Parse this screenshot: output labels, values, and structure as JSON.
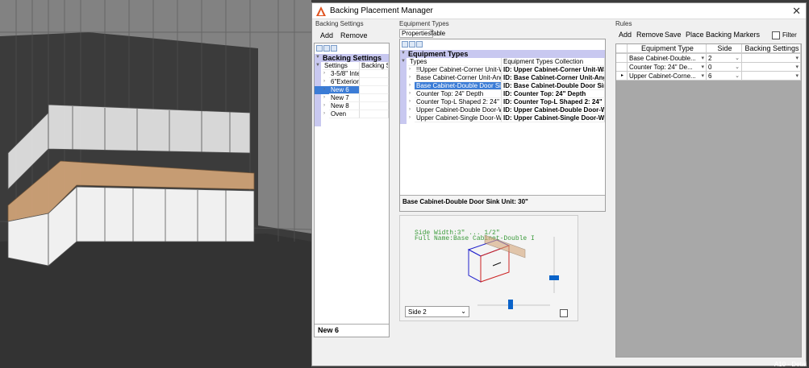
{
  "window": {
    "title": "Backing Placement Manager",
    "close": "✕"
  },
  "backing_settings": {
    "group_label": "Backing Settings",
    "add_label": "Add",
    "remove_label": "Remove",
    "header": "Backing Settings",
    "col_settings": "Settings",
    "col_backing": "Backing Se",
    "items": [
      "3-5/8\" Interi",
      "6\"ExteriorW",
      "New 6",
      "New 7",
      "New 8",
      "Oven"
    ],
    "selected_index": 2,
    "footer": "New 6"
  },
  "equipment_types": {
    "group_label": "Equipment Types",
    "tabs": [
      "Properties",
      "Table"
    ],
    "header": "Equipment Types",
    "col_types": "Types",
    "col_collection": "Equipment Types Collection",
    "rows": [
      {
        "type": "!!Upper Cabinet-Corner Unit-Wa",
        "id": "ID: Upper Cabinet-Corner Unit-Wall"
      },
      {
        "type": "Base Cabinet-Corner Unit-Angle",
        "id": "ID: Base Cabinet-Corner Unit-Angle"
      },
      {
        "type": "Base Cabinet-Double Door Sink",
        "id": "ID: Base Cabinet-Double Door Sink"
      },
      {
        "type": "Counter Top: 24\" Depth",
        "id": "ID: Counter Top: 24\" Depth"
      },
      {
        "type": "Counter Top-L Shaped 2: 24\" De",
        "id": "ID: Counter Top-L Shaped 2: 24\" De"
      },
      {
        "type": "Upper Cabinet-Double Door-Wal",
        "id": "ID: Upper Cabinet-Double Door-Wa"
      },
      {
        "type": "Upper Cabinet-Single Door-Wall",
        "id": "ID: Upper Cabinet-Single Door-Wall"
      }
    ],
    "selected_index": 2,
    "description": "Base Cabinet-Double Door Sink Unit: 30\""
  },
  "preview": {
    "text_line1": "Side Width:3\"  ... 1/2\"",
    "text_line2": "Full Name:Base Cabinet-Double I",
    "side_select": "Side 2"
  },
  "rules": {
    "group_label": "Rules",
    "add_label": "Add",
    "remove_label": "Remove",
    "save_label": "Save",
    "place_label": "Place Backing Markers",
    "filter_label": "Filter",
    "col_equipment": "Equipment Type",
    "col_side": "Side",
    "col_backing": "Backing Settings",
    "rows": [
      {
        "equipment": "Base Cabinet-Double...",
        "side": "2",
        "backing": ""
      },
      {
        "equipment": "Counter Top: 24\" De...",
        "side": "0",
        "backing": ""
      },
      {
        "equipment": "Upper Cabinet-Corne...",
        "side": "6",
        "backing": ""
      }
    ]
  },
  "statusbar": {
    "text": "A10 - Detai"
  }
}
